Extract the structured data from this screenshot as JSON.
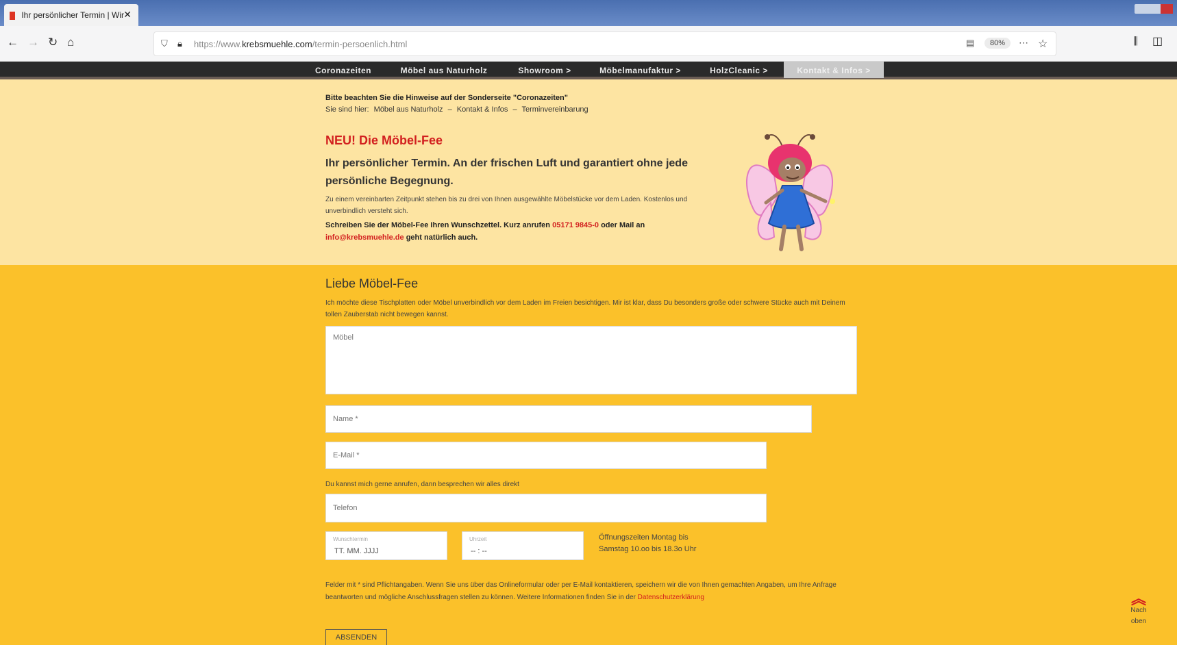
{
  "browser": {
    "tab_title": "Ihr persönlicher Termin | Wir",
    "url_prefix": "https://www.",
    "url_domain": "krebsmuehle.com",
    "url_path": "/termin-persoenlich.html",
    "zoom": "80%"
  },
  "menu": {
    "items": [
      {
        "label": "Coronazeiten"
      },
      {
        "label": "Möbel aus Naturholz"
      },
      {
        "label": "Showroom >"
      },
      {
        "label": "Möbelmanufaktur >"
      },
      {
        "label": "HolzCleanic >"
      },
      {
        "label": "Kontakt & Infos >"
      }
    ]
  },
  "info": {
    "note": "Bitte beachten Sie die Hinweise auf der Sonderseite \"Coronazeiten\"",
    "breadcrumb": {
      "prefix": "Sie sind hier:",
      "items": [
        "Möbel aus Naturholz",
        "–",
        "Kontakt & Infos",
        "–",
        "Terminvereinbarung"
      ]
    },
    "neu_title": "NEU! Die Möbel-Fee",
    "headline": "Ihr persönlicher Termin. An der frischen Luft und garantiert ohne jede persönliche Begegnung.",
    "description": "Zu einem vereinbarten Zeitpunkt stehen bis zu drei von Ihnen ausgewählte Möbelstücke vor dem Laden. Kostenlos und unverbindlich versteht sich.",
    "write_text_1": "Schreiben Sie der Möbel-Fee Ihren Wunschzettel. Kurz anrufen",
    "phone": "05171 9845-0",
    "write_text_2": "oder Mail an",
    "email": "info@krebsmuehle.de",
    "write_text_3": "geht natürlich auch."
  },
  "form": {
    "heading": "Liebe Möbel-Fee",
    "intro": "Ich möchte diese Tischplatten oder Möbel unverbindlich vor dem Laden im Freien besichtigen. Mir ist klar, dass Du besonders große oder schwere Stücke auch mit Deinem tollen Zauberstab nicht bewegen kannst.",
    "furniture_placeholder": "Möbel",
    "name_placeholder": "Name *",
    "email_placeholder": "E-Mail *",
    "phone_hint": "Du kannst mich gerne anrufen, dann besprechen wir alles direkt",
    "phone_placeholder": "Telefon",
    "date_label": "Wunschtermin",
    "date_value": "TT. MM. JJJJ",
    "time_label": "Uhrzeit",
    "time_value": "-- : --",
    "hours_text": "Öffnungszeiten Montag bis Samstag 10.oo bis 18.3o Uhr",
    "legal_text": "Felder mit * sind Pflichtangaben. Wenn Sie uns über das Onlineformular oder per E-Mail kontaktieren, speichern wir die von Ihnen gemachten Angaben, um Ihre Anfrage beantworten und mögliche Anschlussfragen stellen zu können. Weitere Informationen finden Sie in der",
    "legal_link": "Datenschutzerklärung",
    "submit_label": "ABSENDEN"
  },
  "to_top": {
    "label_1": "Nach",
    "label_2": "oben"
  }
}
